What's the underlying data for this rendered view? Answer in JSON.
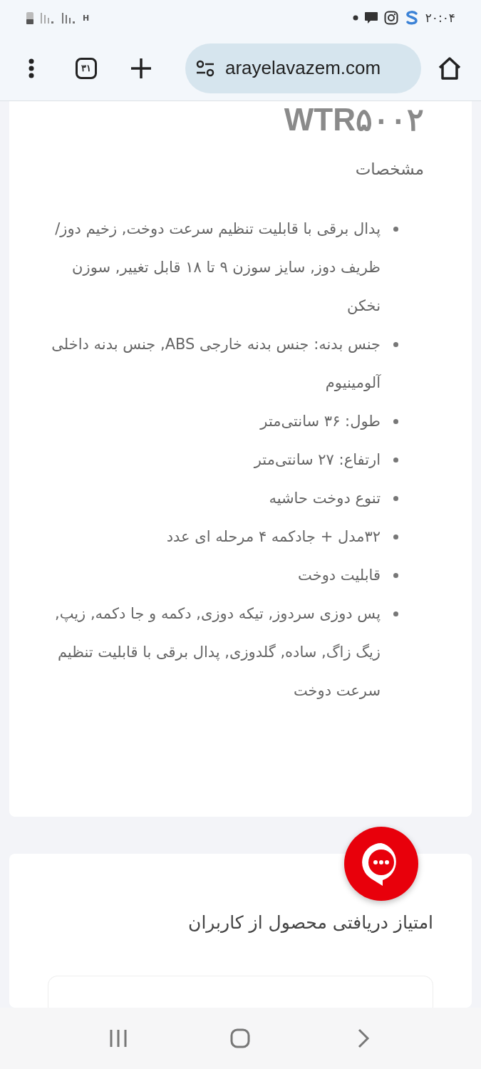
{
  "status_bar": {
    "time": "۲۰:۰۴",
    "network": "H"
  },
  "browser": {
    "url": "arayelavazem.com",
    "tab_count": "۳۱"
  },
  "product": {
    "model": "WTR۵۰۰۲",
    "section_title": "مشخصات",
    "specs": [
      "پدال برقی با قابلیت تنظیم سرعت دوخت, زخیم دوز/ظریف دوز, سایز سوزن ۹ تا ۱۸ قابل تغییر, سوزن نخکن",
      "جنس بدنه: جنس بدنه خارجی ABS, جنس بدنه داخلی آلومینیوم",
      "طول: ۳۶ سانتی‌متر",
      "ارتفاع: ۲۷ سانتی‌متر",
      "تنوع دوخت حاشیه",
      "۳۲مدل + جادکمه ۴ مرحله ای عدد",
      "قابلیت دوخت",
      "پس دوزی سردوز, تیکه دوزی, دکمه و جا دکمه, زیپ, زیگ زاگ, ساده, گلدوزی, پدال برقی با قابلیت تنظیم سرعت دوخت"
    ]
  },
  "reviews": {
    "title": "امتیاز دریافتی محصول از کاربران"
  }
}
